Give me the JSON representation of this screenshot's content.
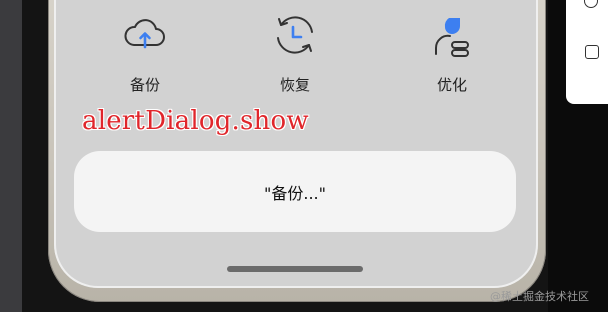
{
  "actions": [
    {
      "label": "备份",
      "icon": "cloud-upload-icon"
    },
    {
      "label": "恢复",
      "icon": "clock-restore-icon"
    },
    {
      "label": "优化",
      "icon": "user-optimize-icon"
    }
  ],
  "annotation": "alertDialog.show",
  "dialog": {
    "message": "\"备份...\""
  },
  "watermark": "@稀土掘金技术社区",
  "colors": {
    "accent": "#3d7ff0",
    "annotation": "#e0262b",
    "dialog_bg": "#f4f4f4",
    "screen_bg": "#d2d2d2"
  }
}
